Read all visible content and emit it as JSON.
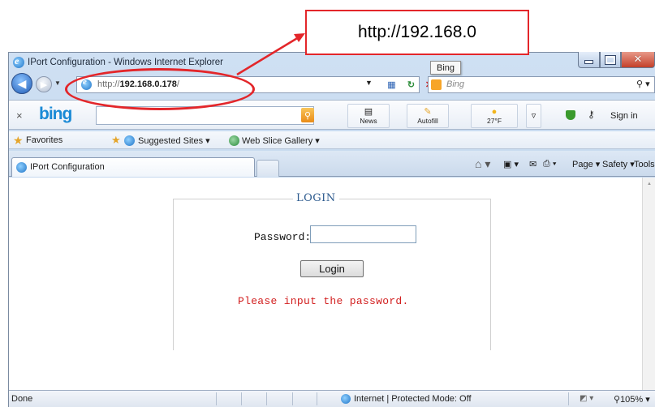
{
  "callout": {
    "text": "http://192.168.0"
  },
  "window": {
    "title": "IPort Configuration - Windows Internet Explorer",
    "tooltip": "Bing"
  },
  "address_bar": {
    "prefix": "http://",
    "host": "192.168.0.178",
    "suffix": "/"
  },
  "search": {
    "placeholder": "Bing"
  },
  "toolbar": {
    "close": "×",
    "logo": "bing",
    "news": "News",
    "autofill": "Autofill",
    "weather": "27°F",
    "sign_in": "Sign in"
  },
  "favorites": {
    "label": "Favorites",
    "suggested": "Suggested Sites ▾",
    "web_slice": "Web Slice Gallery ▾"
  },
  "tab": {
    "label": "IPort Configuration"
  },
  "commands": {
    "page": "Page ▾",
    "safety": "Safety ▾",
    "tools": "Tools ▾"
  },
  "login": {
    "legend": "LOGIN",
    "password_label": "Password:",
    "button": "Login",
    "message": "Please input the password."
  },
  "status": {
    "left": "Done",
    "zone": "Internet | Protected Mode: Off",
    "zoom": "105%"
  },
  "colors": {
    "callout": "#e3262a",
    "legend": "#2c5a8e",
    "message": "#d21f1f"
  }
}
